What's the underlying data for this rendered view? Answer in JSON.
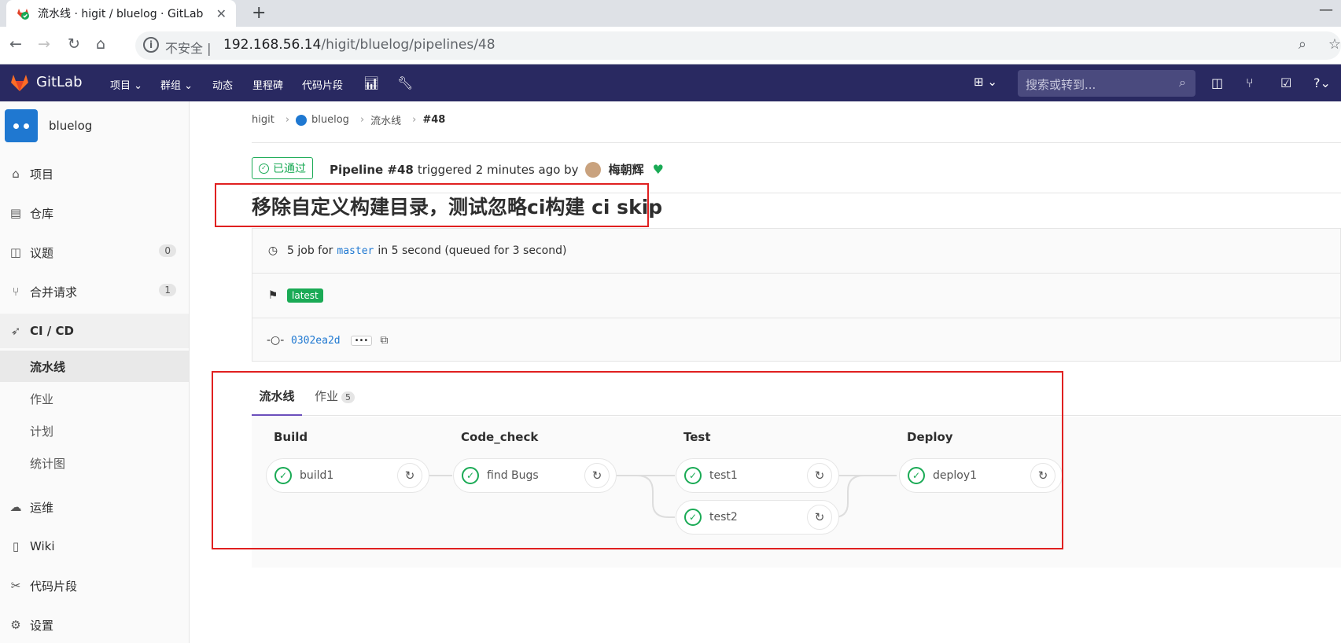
{
  "browser": {
    "tab_title": "流水线 · higit / bluelog · GitLab",
    "close": "✕",
    "new_tab": "+",
    "min": "—",
    "insecure": "不安全",
    "url_host": "192.168.56.14",
    "url_path": "/higit/bluelog/pipelines/48"
  },
  "gitlab_nav": {
    "brand": "GitLab",
    "menus": [
      "项目 ⌄",
      "群组 ⌄",
      "动态",
      "里程碑",
      "代码片段"
    ],
    "search_placeholder": "搜索或转到..."
  },
  "sidebar": {
    "project_name": "bluelog",
    "items": [
      {
        "label": "项目",
        "icon": "home-icon",
        "glyph": "⌂"
      },
      {
        "label": "仓库",
        "icon": "repo-icon",
        "glyph": "▤"
      },
      {
        "label": "议题",
        "icon": "issues-icon",
        "glyph": "◫",
        "count": "0"
      },
      {
        "label": "合并请求",
        "icon": "merge-request-icon",
        "glyph": "⑂",
        "count": "1"
      },
      {
        "label": "CI / CD",
        "icon": "rocket-icon",
        "glyph": "➶"
      }
    ],
    "cicd_sub": [
      "流水线",
      "作业",
      "计划",
      "统计图"
    ],
    "bottom_items": [
      {
        "label": "运维",
        "icon": "operations-icon",
        "glyph": "☁"
      },
      {
        "label": "Wiki",
        "icon": "book-icon",
        "glyph": "▯"
      },
      {
        "label": "代码片段",
        "icon": "snippet-icon",
        "glyph": "✂"
      },
      {
        "label": "设置",
        "icon": "settings-icon",
        "glyph": "⚙"
      }
    ]
  },
  "breadcrumb": [
    "higit",
    "bluelog",
    "流水线",
    "#48"
  ],
  "pipeline": {
    "status": "已通过",
    "pipeline_label": "Pipeline #48",
    "triggered_text": "triggered 2 minutes ago by",
    "user": "梅朝辉",
    "title": "移除自定义构建目录，测试忽略ci构建 ci skip",
    "jobs_pre": "5 job for",
    "branch": "master",
    "jobs_post": "in 5 second (queued for 3 second)",
    "tag": "latest",
    "commit": "0302ea2d",
    "ellipsis": "•••"
  },
  "tabs": {
    "pipeline": "流水线",
    "jobs": "作业",
    "jobs_count": "5"
  },
  "stages": [
    {
      "name": "Build",
      "jobs": [
        "build1"
      ]
    },
    {
      "name": "Code_check",
      "jobs": [
        "find Bugs"
      ]
    },
    {
      "name": "Test",
      "jobs": [
        "test1",
        "test2"
      ]
    },
    {
      "name": "Deploy",
      "jobs": [
        "deploy1"
      ]
    }
  ],
  "colors": {
    "nav": "#292961",
    "success": "#1aaa55",
    "highlight": "#e02020"
  }
}
